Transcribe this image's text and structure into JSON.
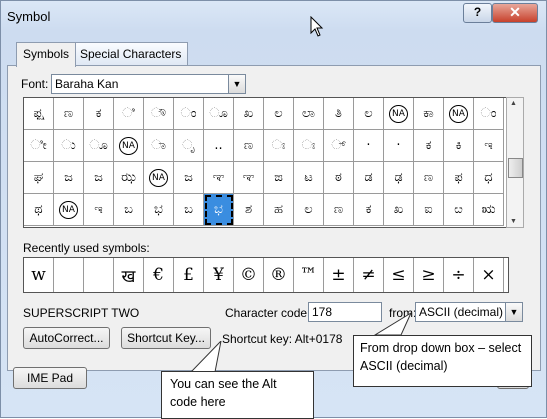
{
  "window": {
    "title": "Symbol",
    "help_label": "?",
    "close_label": "✕"
  },
  "tabs": [
    {
      "label": "Symbols",
      "active": true
    },
    {
      "label": "Special Characters",
      "active": false
    }
  ],
  "font": {
    "label": "Font:",
    "value": "Baraha Kan"
  },
  "symbol_grid": {
    "rows": [
      [
        "ಫ್ಷ",
        "ಣ",
        "ಕ",
        "ಿ",
        "ೌ",
        "ಂ",
        "ೂ",
        "ಖ",
        "ಲ",
        "ಲಾ",
        "ತಿ",
        "ಲ",
        "NA",
        "ಕಾ",
        "NA",
        "ಂ"
      ],
      [
        "ೀ",
        "ು",
        "ೂ",
        "NA",
        "ಾ",
        "ೃ",
        "..",
        "ಣ",
        "ಃ",
        "ಃ",
        "್",
        "·",
        "·",
        "ಕ",
        "ಕಿ",
        "ಇ"
      ],
      [
        "ಘ",
        "ಜ",
        "ಜ",
        "ಝ",
        "NA",
        "ಜ",
        "ಞ",
        "ಞ",
        "ಙ",
        "ಟ",
        "ಠ",
        "ಡ",
        "ಢ",
        "ಣ",
        "ಫ",
        "ಧ"
      ],
      [
        "ಥ",
        "NA",
        "ಇ",
        "ಬ",
        "ಭ",
        "ಬ",
        "ಭ",
        "ಶ",
        "ಹ",
        "ಲ",
        "ಣ",
        "ಕ",
        "ಖ",
        "ಐ",
        "ೞ",
        "ಋ"
      ]
    ],
    "selected": {
      "row": 3,
      "col": 6
    }
  },
  "recent": {
    "label": "Recently used symbols:",
    "symbols": [
      "w",
      "",
      "",
      "ख",
      "€",
      "£",
      "¥",
      "©",
      "®",
      "™",
      "±",
      "≠",
      "≤",
      "≥",
      "÷",
      "×"
    ]
  },
  "char_name": "SUPERSCRIPT TWO",
  "char_code": {
    "label": "Character code:",
    "value": "178"
  },
  "from": {
    "label": "from:",
    "value": "ASCII (decimal)"
  },
  "buttons": {
    "autocorrect": "AutoCorrect...",
    "shortcut_key": "Shortcut Key...",
    "ime_pad": "IME Pad",
    "ok_partial": "l"
  },
  "shortcut_key_text": "Shortcut key: Alt+0178",
  "callouts": {
    "ascii": "From drop down box – select ASCII (decimal)",
    "alt_code": "You can see the Alt code here"
  }
}
